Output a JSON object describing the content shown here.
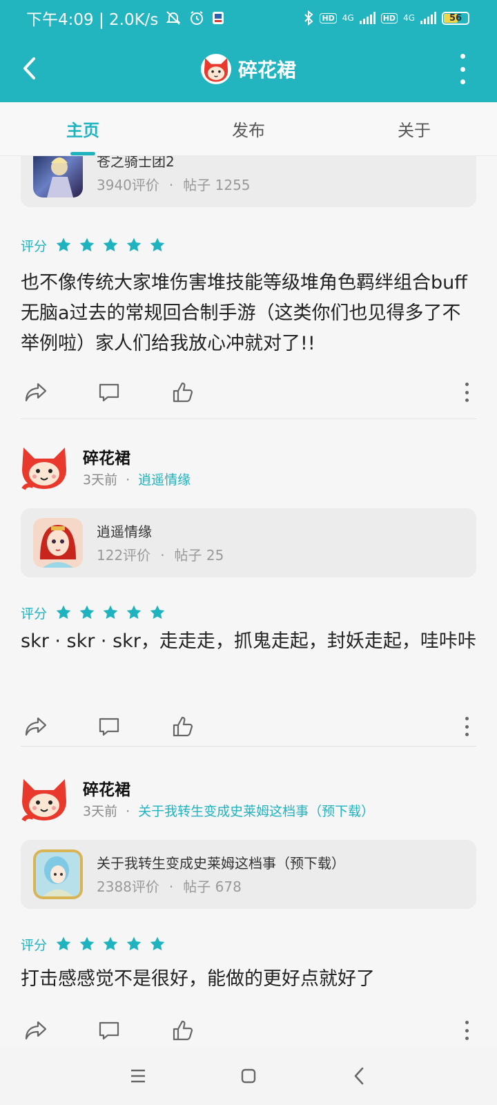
{
  "status_bar": {
    "time_speed": "下午4:09 | 2.0K/s",
    "net1": "4G",
    "net2": "4G",
    "hd": "HD",
    "battery": "56",
    "battery_level": 0.56
  },
  "header": {
    "title": "碎花裙"
  },
  "tabs": [
    {
      "label": "主页",
      "active": true
    },
    {
      "label": "发布",
      "active": false
    },
    {
      "label": "关于",
      "active": false
    }
  ],
  "posts": [
    {
      "game": {
        "name": "苍之骑士团2",
        "ratings": "3940评价",
        "posts": "帖子 1255"
      },
      "rating_label": "评分",
      "stars": 5,
      "text": "也不像传统大家堆伤害堆技能等级堆角色羁绊组合buff无脑a过去的常规回合制手游（这类你们也见得多了不举例啦）家人们给我放心冲就对了!!"
    },
    {
      "author": {
        "name": "碎花裙",
        "time": "3天前",
        "game_link": "逍遥情缘"
      },
      "game": {
        "name": "逍遥情缘",
        "ratings": "122评价",
        "posts": "帖子 25"
      },
      "rating_label": "评分",
      "stars": 5,
      "text": "skr · skr · skr，走走走，抓鬼走起，封妖走起，哇咔咔"
    },
    {
      "author": {
        "name": "碎花裙",
        "time": "3天前",
        "game_link": "关于我转生变成史莱姆这档事（预下载）"
      },
      "game": {
        "name": "关于我转生变成史莱姆这档事（预下载）",
        "ratings": "2388评价",
        "posts": "帖子 678"
      },
      "rating_label": "评分",
      "stars": 5,
      "text": "打击感感觉不是很好，能做的更好点就好了"
    }
  ],
  "colors": {
    "accent": "#22b4bf",
    "star": "#1fb3bf"
  }
}
